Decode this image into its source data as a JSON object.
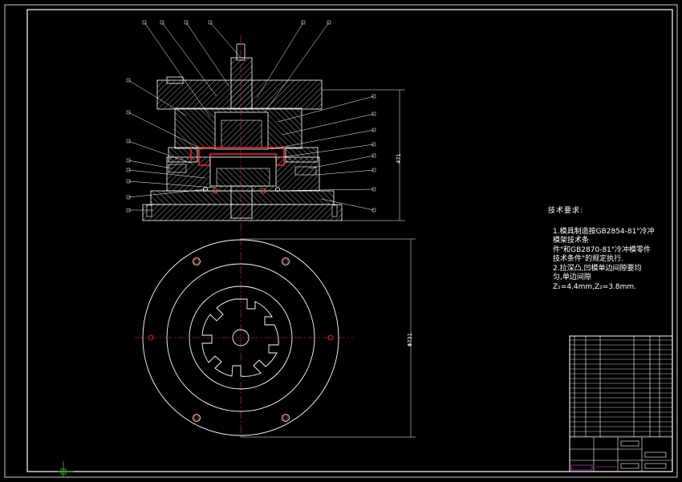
{
  "drawing": {
    "tech_requirements_title": "技术要求:",
    "tech_requirements_lines": [
      "1.模具制造按GB2854-81\"冷冲",
      "模架技术条",
      "件\"和GB2870-81\"冷冲模零件",
      "技术条件\"的规定执行.",
      "2.拉深凸,凹模单边间隙要均",
      "匀,单边间隙",
      "Z₁=4.4mm,Z₂=3.8mm."
    ],
    "dim_height": "471",
    "dim_diameter": "Φ731"
  }
}
